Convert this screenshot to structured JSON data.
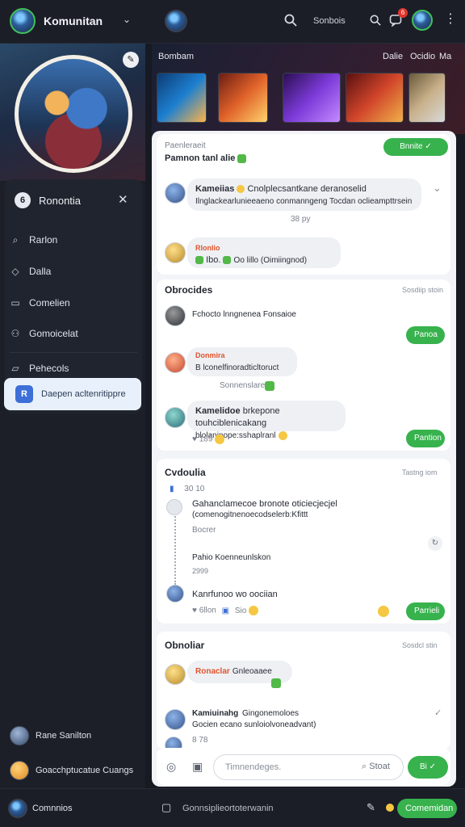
{
  "topbar": {
    "app_title": "Komunitan",
    "dropdown_icon": "chevron-down",
    "search_link": "Sonbois",
    "notification_count": "6"
  },
  "sidebar": {
    "menu_header": "Ronontia",
    "items": [
      {
        "label": "Rarlon",
        "icon": "search-icon"
      },
      {
        "label": "Dalla",
        "icon": "shield-icon"
      },
      {
        "label": "Comelien",
        "icon": "calendar-icon"
      },
      {
        "label": "Gomoicelat",
        "icon": "people-icon"
      },
      {
        "label": "Pehecols",
        "icon": "chat-icon"
      }
    ],
    "active_item": "Daepen acltenritippre",
    "active_badge": "R",
    "users": [
      {
        "name": "Rane Sanilton"
      },
      {
        "name": "Goacchptucatue Cuangs"
      }
    ],
    "footer_user": "Comnnios"
  },
  "banner": {
    "left_label": "Bombam",
    "right_labels": [
      "Dalie",
      "Ocidio",
      "Ma"
    ]
  },
  "post": {
    "author": "Paenleraeit",
    "title": "Pamnon tanl alie",
    "join_button": "Bnnite",
    "comment_author": "Kameiias",
    "comment_line1": "Cnolplecsantkane deranoselid",
    "comment_line2": "Ilnglackearlunieeaeno conmanngeng Tocdan oclieampttrsein",
    "comment_time": "38 py",
    "reaction_tag": "Rlonlio",
    "reaction_text": "Ibo.",
    "reaction_stats": "Oo lillo  (Oimiingnod)"
  },
  "section1": {
    "title": "Obrocides",
    "time": "Sosdiip stoin",
    "reply1": "Fchocto lnngnenea Fonsaioe",
    "button1": "Panoa",
    "tag2": "Donmira",
    "reply2": "B lconelfinoradticltoruct",
    "meta2": "Sonnenslare",
    "reply3_author": "Kamelidoe",
    "reply3_line1": "brkepone touhciblenicakang",
    "reply3_line2": "blolaninope:sshaplranl",
    "reply3_stats": "189",
    "button2": "Pantion"
  },
  "section2": {
    "title": "Cvdoulia",
    "time": "Tastng iom",
    "count": "30 10",
    "thread1_line1": "Gahanclamecoe bronote oticiecjecjel",
    "thread1_line2": "(comenogitnenoecodselerb:Kfittt",
    "thread1_meta": "Bocrer",
    "thread2": "Pahio Koenneunlskon",
    "thread2_meta": "2999",
    "thread3": "Kanrfunoo wo oociian",
    "stats": "6llon",
    "stats2": "Sio",
    "button": "Parrieli"
  },
  "section3": {
    "title": "Obnoliar",
    "time": "Sosdcl stin",
    "reply1_tag": "Ronaclar",
    "reply1": "Gnleoaaee",
    "reply2_author": "Kamiuinahg",
    "reply2_line1": "Gingonemoloes",
    "reply2_line2": "Gocien ecano sunloiolvoneadvant)",
    "reply2_stats": "8 78"
  },
  "composer": {
    "placeholder": "Timnendeges.",
    "search_label": "Stoat",
    "send_label": "Bi"
  },
  "bottombar": {
    "center_text": "Gonnsiplieortoterwanin",
    "action_button": "Comemidan"
  },
  "colors": {
    "accent_green": "#37b24d",
    "brand_blue": "#3d6fd8",
    "badge_red": "#e0542c"
  }
}
